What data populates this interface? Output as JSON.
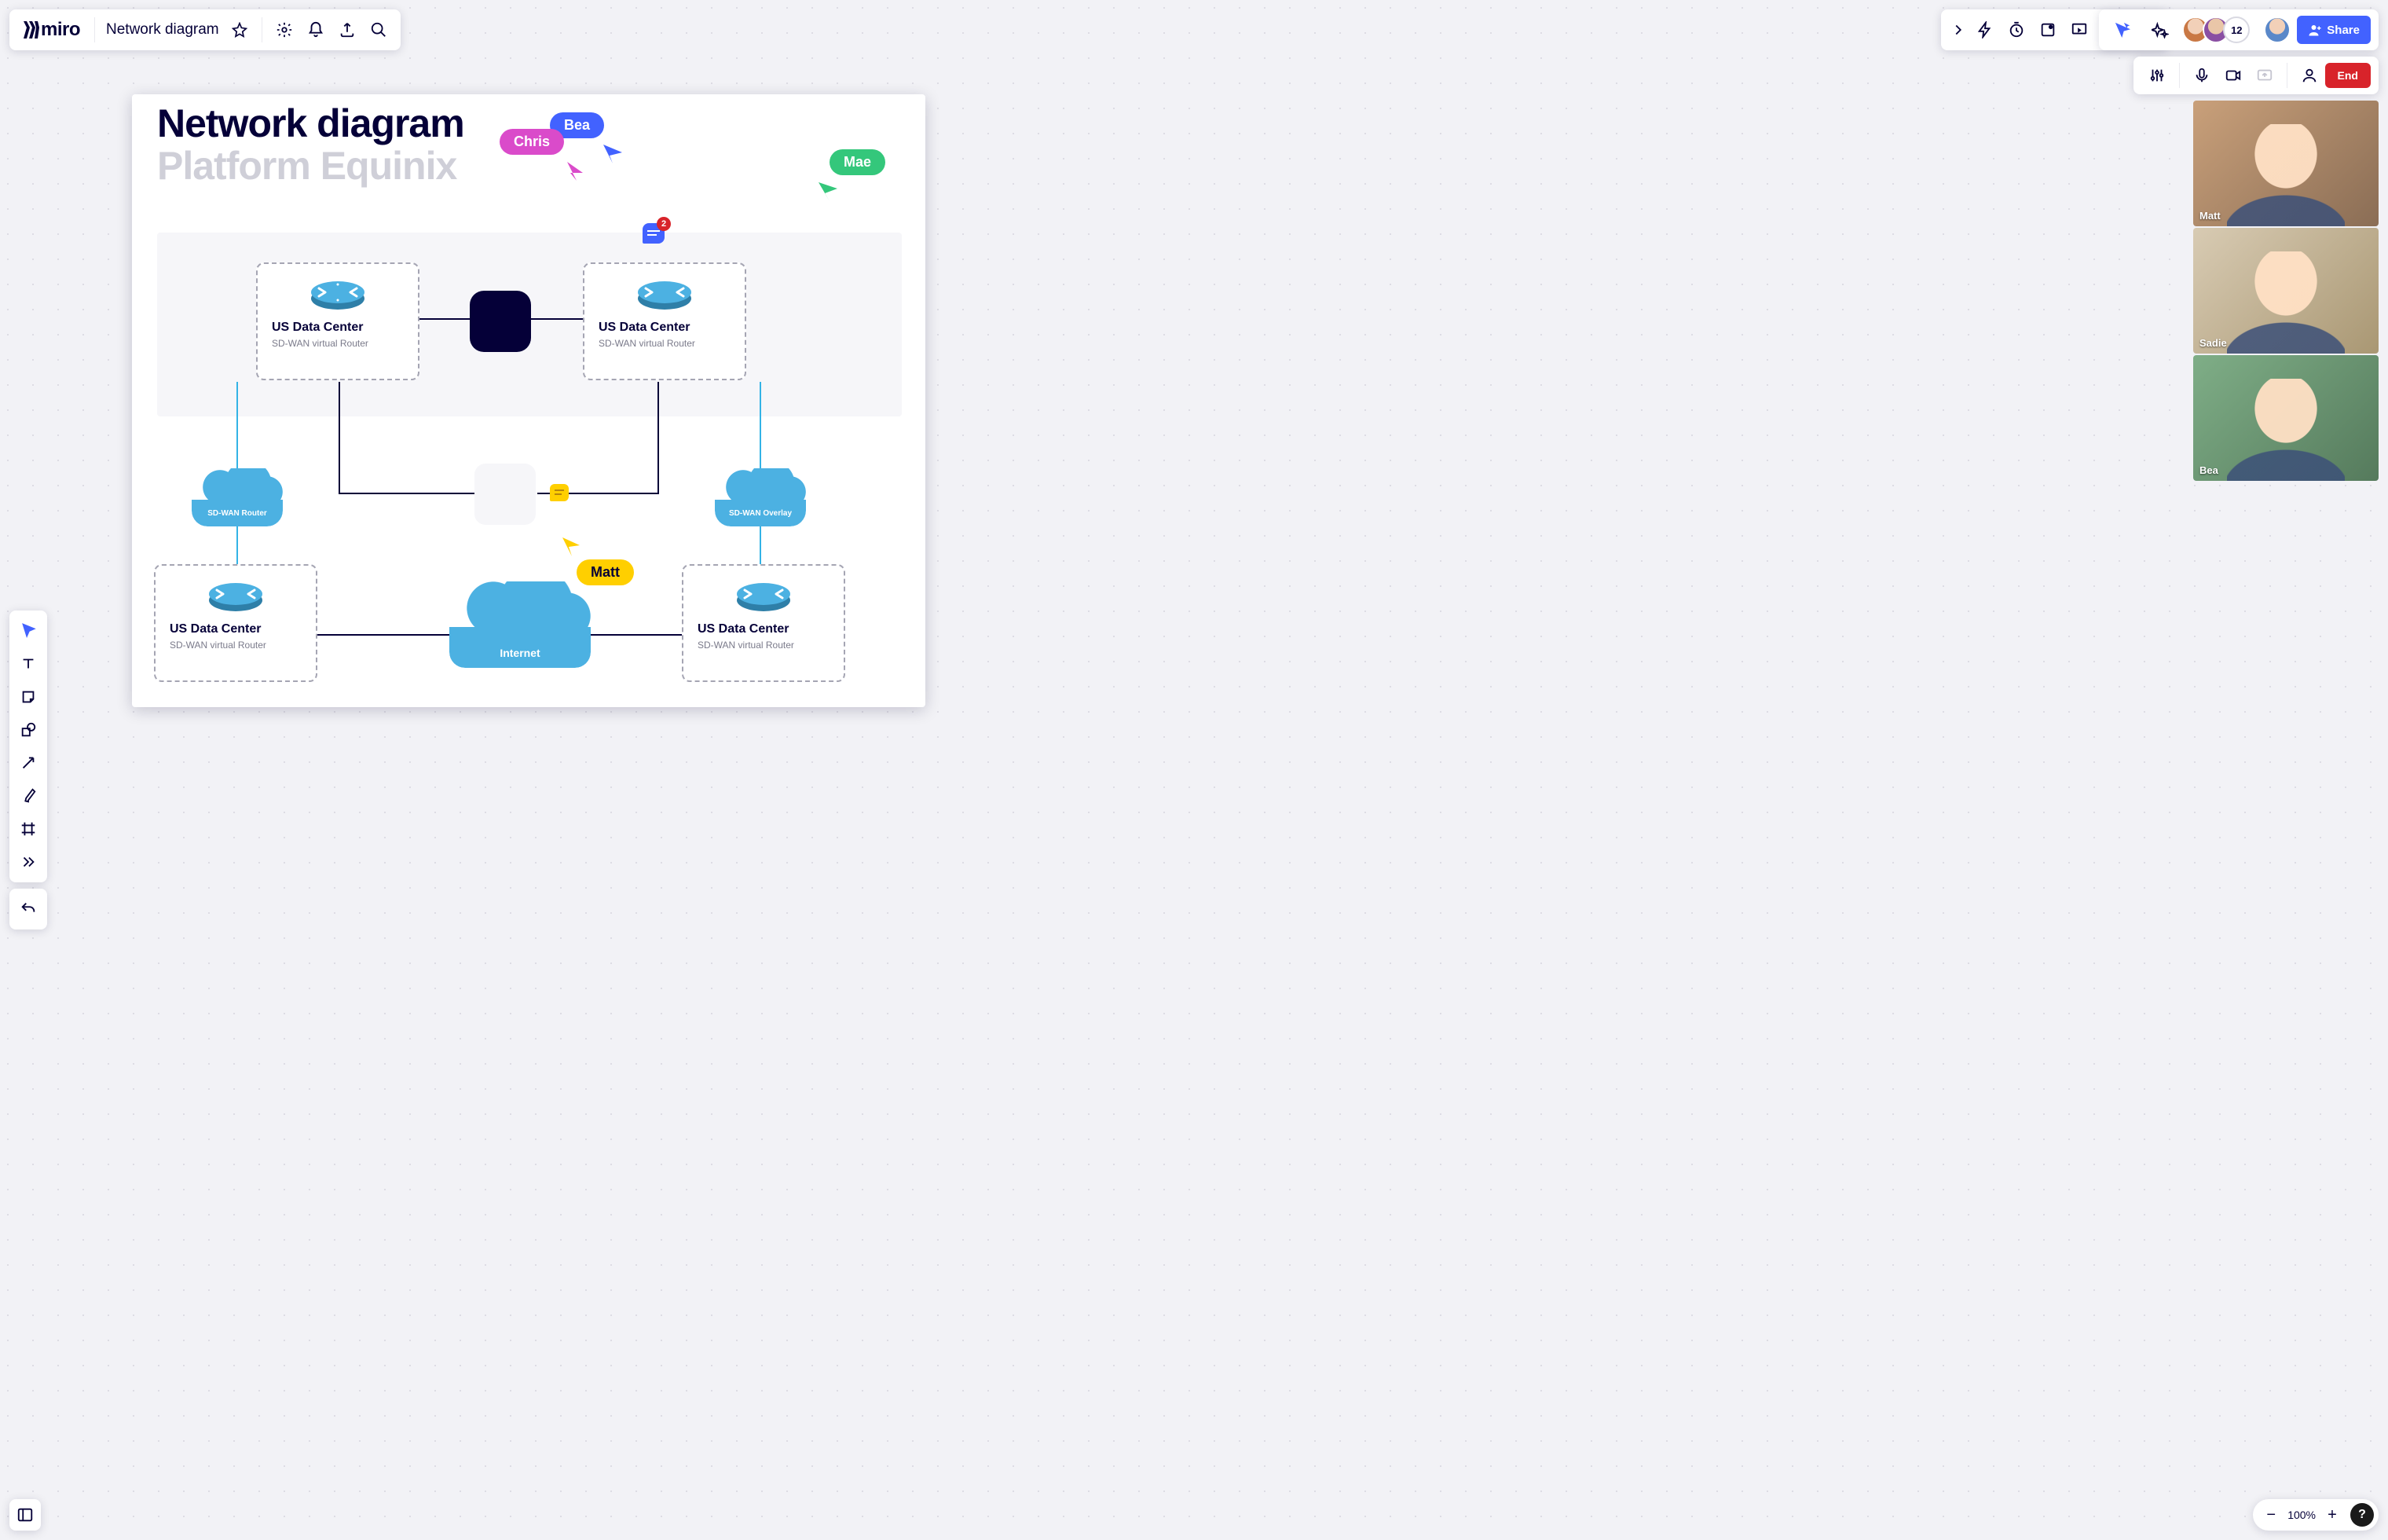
{
  "header": {
    "brand": "miro",
    "board_name": "Network diagram",
    "avatar_overflow": "12",
    "share": "Share"
  },
  "live": {
    "end": "End"
  },
  "zoom": {
    "value": "100%"
  },
  "title": {
    "line1": "Network diagram",
    "line2": "Platform Equinix"
  },
  "nodes": {
    "n1": {
      "name": "US Data Center",
      "desc": "SD-WAN virtual Router"
    },
    "n2": {
      "name": "US Data Center",
      "desc": "SD-WAN virtual Router"
    },
    "n3": {
      "name": "US Data Center",
      "desc": "SD-WAN virtual Router"
    },
    "n4": {
      "name": "US Data Center",
      "desc": "SD-WAN virtual Router"
    }
  },
  "clouds": {
    "left": "SD-WAN\nRouter",
    "right": "SD-WAN\nOverlay",
    "internet": "Internet"
  },
  "comments": {
    "top_badge": "2"
  },
  "cursors": {
    "bea": "Bea",
    "chris": "Chris",
    "mae": "Mae",
    "matt": "Matt"
  },
  "videos": {
    "v1": "Matt",
    "v2": "Sadie",
    "v3": "Bea"
  }
}
